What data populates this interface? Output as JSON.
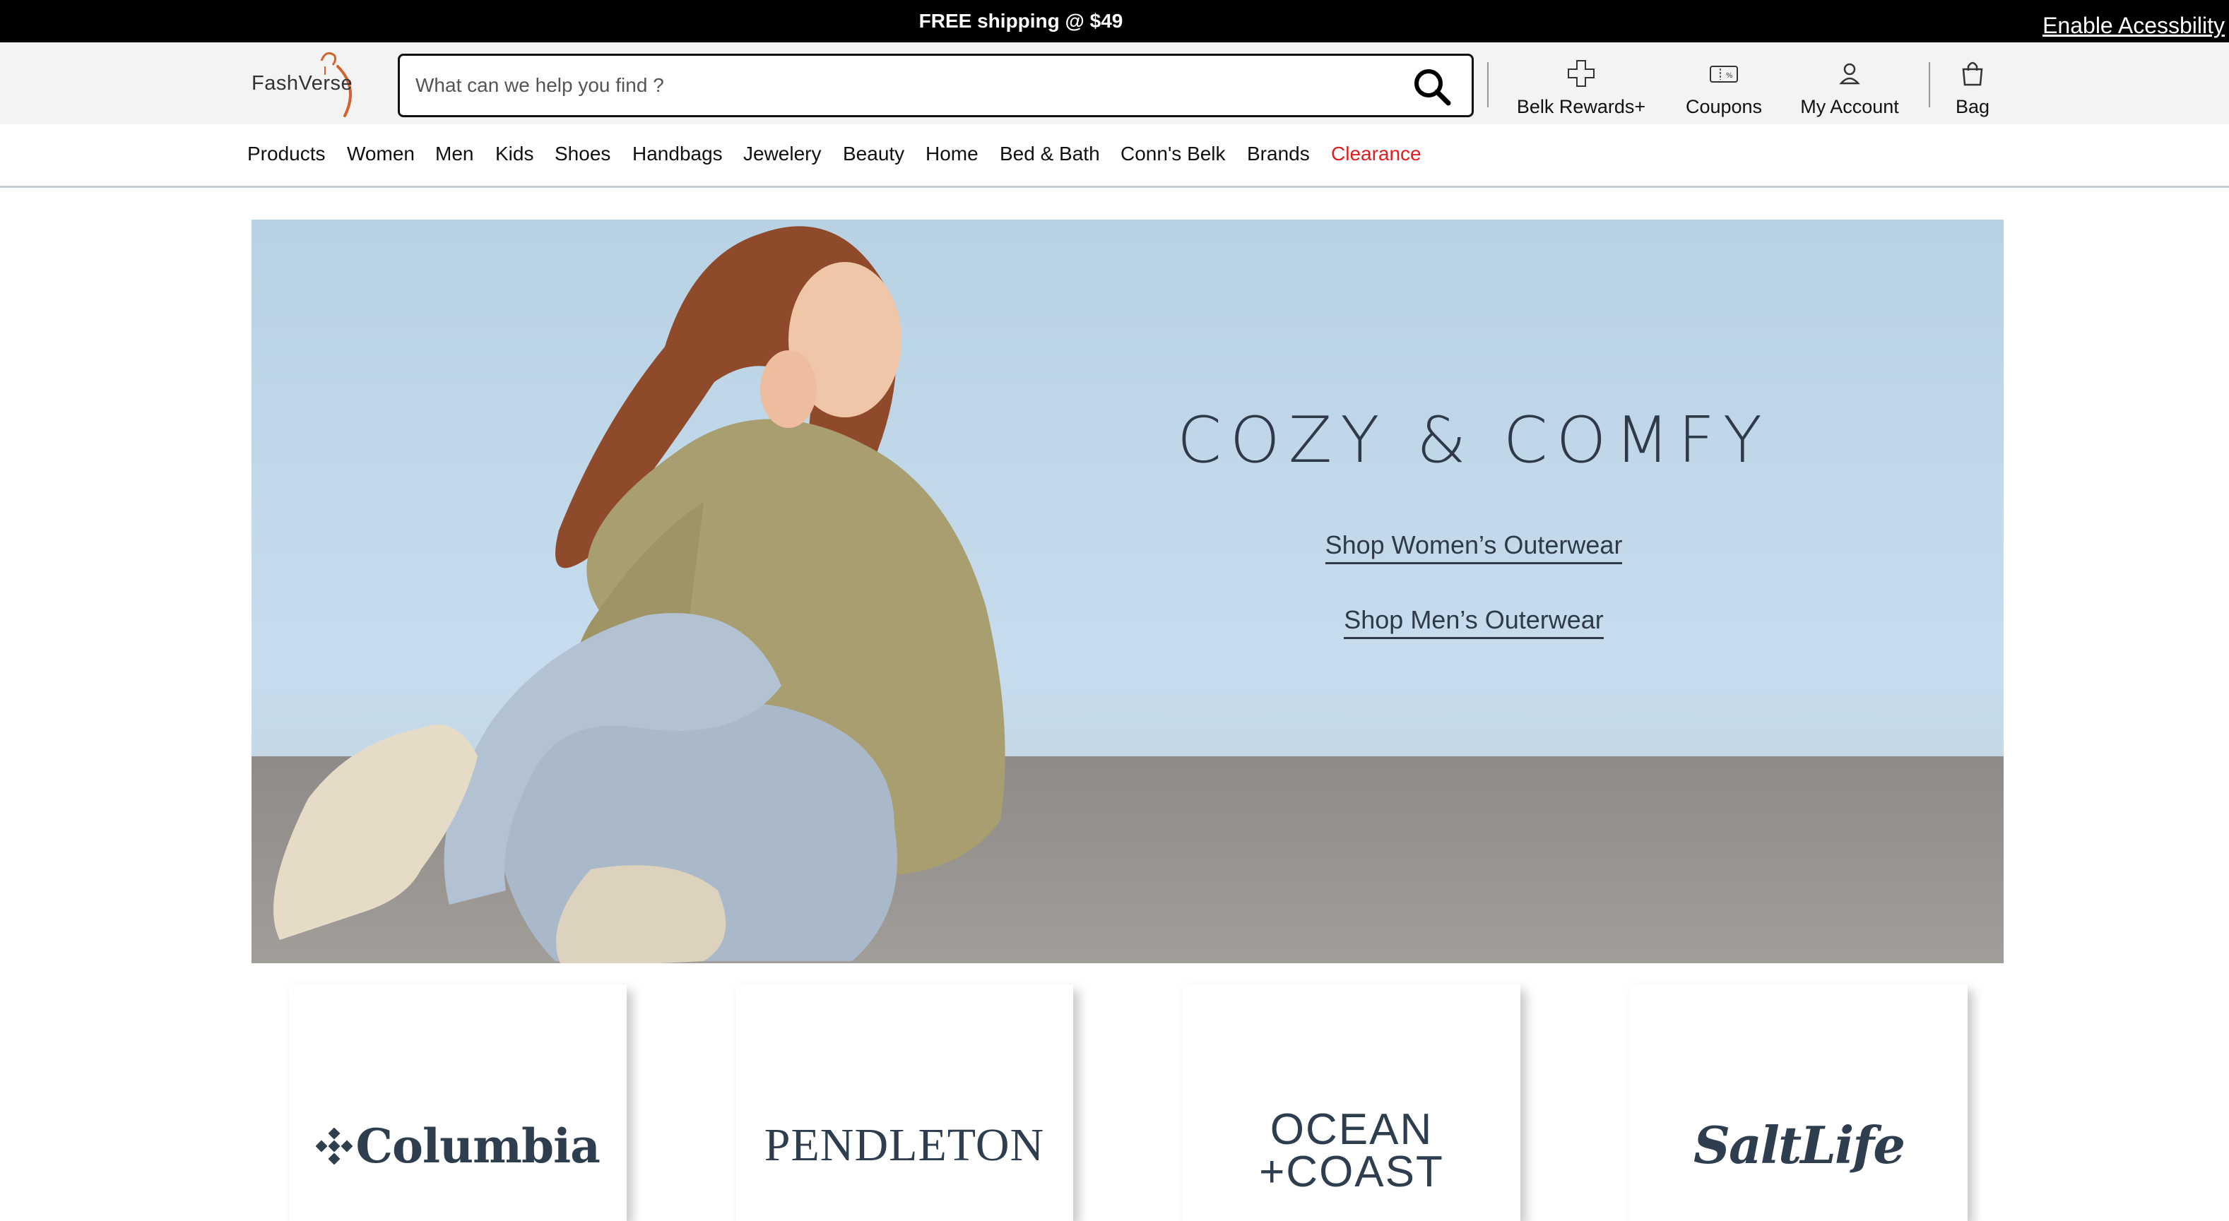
{
  "promo": {
    "text": "FREE shipping @ $49",
    "accessibility_link": "Enable Acessbility"
  },
  "logo": {
    "text": "FashVerse"
  },
  "search": {
    "placeholder": "What can we help you find ?"
  },
  "utility": {
    "rewards": "Belk Rewards+",
    "coupons": "Coupons",
    "account": "My Account",
    "bag": "Bag"
  },
  "nav": {
    "items": [
      "Products",
      "Women",
      "Men",
      "Kids",
      "Shoes",
      "Handbags",
      "Jewelery",
      "Beauty",
      "Home",
      "Bed & Bath",
      "Conn's Belk",
      "Brands"
    ],
    "clearance": "Clearance"
  },
  "hero": {
    "title": "COZY & COMFY",
    "link_women": "Shop Women’s Outerwear",
    "link_men": "Shop Men’s Outerwear"
  },
  "brands": [
    "Columbia",
    "PENDLETON",
    "OCEAN",
    "+COAST",
    "SaltLife"
  ],
  "colors": {
    "clearance": "#e01e1e",
    "hero_text": "#2e3a47",
    "promo_bg": "#000000",
    "logo_accent": "#d4622f"
  }
}
